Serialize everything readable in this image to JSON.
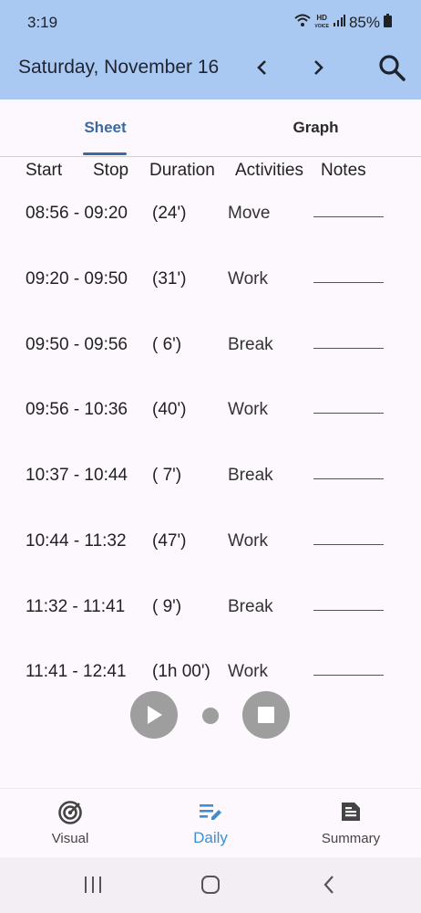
{
  "status_bar": {
    "time": "3:19",
    "battery": "85%",
    "hd_top": "HD",
    "hd_bottom": "VOICE"
  },
  "header": {
    "date": "Saturday, November 16"
  },
  "tabs": [
    {
      "label": "Sheet",
      "selected": true
    },
    {
      "label": "Graph",
      "selected": false
    }
  ],
  "columns": {
    "start": "Start",
    "stop": "Stop",
    "duration": "Duration",
    "activities": "Activities",
    "notes": "Notes"
  },
  "rows": [
    {
      "time": "08:56 - 09:20",
      "duration": "(24')",
      "activity": "Move"
    },
    {
      "time": "09:20 - 09:50",
      "duration": "(31')",
      "activity": "Work"
    },
    {
      "time": "09:50 - 09:56",
      "duration": "( 6')",
      "activity": "Break"
    },
    {
      "time": "09:56 - 10:36",
      "duration": "(40')",
      "activity": "Work"
    },
    {
      "time": "10:37 - 10:44",
      "duration": "( 7')",
      "activity": "Break"
    },
    {
      "time": "10:44 - 11:32",
      "duration": "(47')",
      "activity": "Work"
    },
    {
      "time": "11:32 - 11:41",
      "duration": "( 9')",
      "activity": "Break"
    },
    {
      "time": "11:41 - 12:41",
      "duration": "(1h 00')",
      "activity": "Work"
    }
  ],
  "bottom_nav": [
    {
      "label": "Visual",
      "icon": "target-icon"
    },
    {
      "label": "Daily",
      "icon": "edit-list-icon",
      "selected": true
    },
    {
      "label": "Summary",
      "icon": "document-icon"
    }
  ],
  "colors": {
    "appbar": "#a9c8f2",
    "accent": "#3c6aa0",
    "daily_active": "#3f8fd0",
    "fab": "#9e9e9e"
  }
}
